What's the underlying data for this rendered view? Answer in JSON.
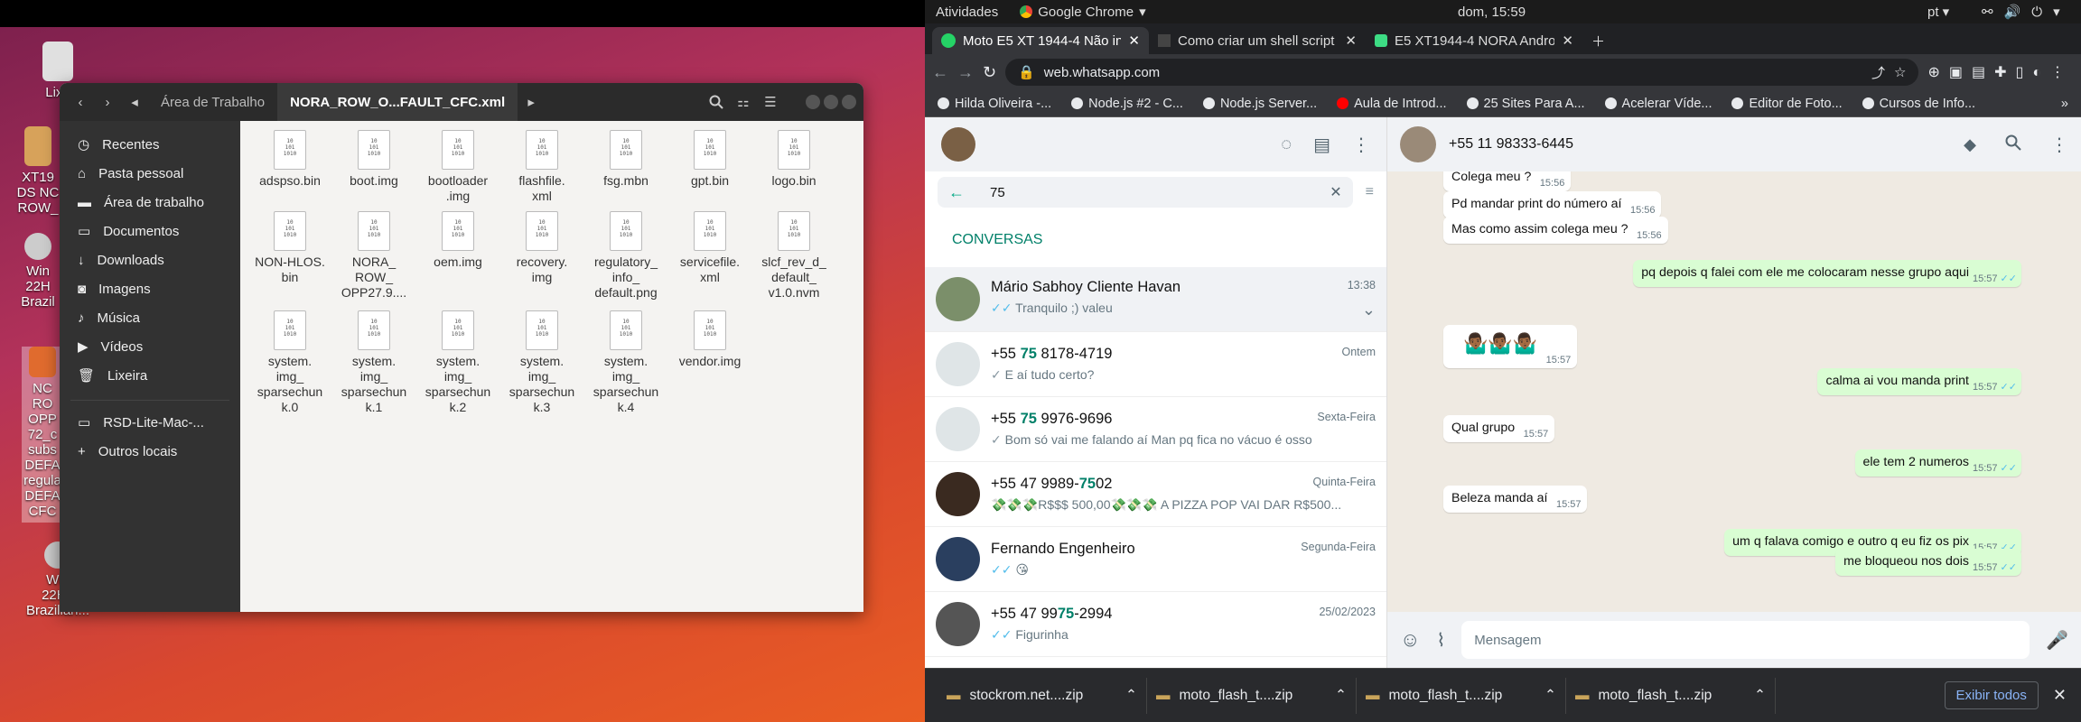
{
  "gnome": {
    "activities": "Atividades",
    "app": "Google Chrome",
    "clock": "dom, 15:59",
    "lang": "pt"
  },
  "desktop": {
    "icons": [
      "Lixe",
      "XT19\nDS NC\nROW_",
      "Win\n22H\nBrazil",
      "NC\nRO\nOPP\n72_c\nsubs\nDEFA\nregula\nDEFA\nCFC",
      "Win\n22H2\nBrazilian..."
    ]
  },
  "files": {
    "breadcrumb": [
      "Área de Trabalho",
      "NORA_ROW_O...FAULT_CFC.xml"
    ],
    "sidebar": [
      "Recentes",
      "Pasta pessoal",
      "Área de trabalho",
      "Documentos",
      "Downloads",
      "Imagens",
      "Música",
      "Vídeos",
      "Lixeira",
      "RSD-Lite-Mac-...",
      "Outros locais"
    ],
    "items": [
      "adspso.bin",
      "boot.img",
      "bootloader\n.img",
      "flashfile.\nxml",
      "fsg.mbn",
      "gpt.bin",
      "logo.bin",
      "NON-HLOS.\nbin",
      "NORA_\nROW_\nOPP27.9....",
      "oem.img",
      "recovery.\nimg",
      "regulatory_\ninfo_\ndefault.png",
      "servicefile.\nxml",
      "slcf_rev_d_\ndefault_\nv1.0.nvm",
      "system.\nimg_\nsparsechun\nk.0",
      "system.\nimg_\nsparsechun\nk.1",
      "system.\nimg_\nsparsechun\nk.2",
      "system.\nimg_\nsparsechun\nk.3",
      "system.\nimg_\nsparsechun\nk.4",
      "vendor.img"
    ]
  },
  "chrome": {
    "tabs": [
      "Moto E5 XT 1944-4 Não ini",
      "Como criar um shell script",
      "E5 XT1944-4 NORA Andro"
    ],
    "url": "web.whatsapp.com",
    "bookmarks": [
      "Hilda Oliveira -...",
      "Node.js #2 - C...",
      "Node.js Server...",
      "Aula de Introd...",
      "25 Sites Para A...",
      "Acelerar Víde...",
      "Editor de Foto...",
      "Cursos de Info..."
    ]
  },
  "wa": {
    "search": "75",
    "section": "CONVERSAS",
    "chats": [
      {
        "name": "Mário Sabhoy Cliente Havan",
        "time": "13:38",
        "last": "Tranquilo ;) valeu"
      },
      {
        "name_a": "+55 ",
        "name_h": "75",
        "name_b": " 8178-4719",
        "time": "Ontem",
        "last": "E aí tudo certo?"
      },
      {
        "name_a": "+55 ",
        "name_h": "75",
        "name_b": " 9976-9696",
        "time": "Sexta-Feira",
        "last": "Bom só vai me falando aí Man pq fica no vácuo é osso"
      },
      {
        "name_a": "+55 47 9989-",
        "name_h": "75",
        "name_b": "02",
        "time": "Quinta-Feira",
        "last": "💸💸💸R$$$ 500,00💸💸💸 A PIZZA POP VAI DAR R$500..."
      },
      {
        "name": "Fernando Engenheiro",
        "time": "Segunda-Feira",
        "last": "😘"
      },
      {
        "name_a": "+55 47 99",
        "name_h": "75",
        "name_b": "-2994",
        "time": "25/02/2023",
        "last": "Figurinha"
      }
    ],
    "contact": "+55 11 98333-6445",
    "messages": [
      {
        "dir": "in",
        "text": "Colega meu ?",
        "time": "15:56"
      },
      {
        "dir": "in",
        "text": "Pd mandar print do número aí",
        "time": "15:56"
      },
      {
        "dir": "in",
        "text": "Mas como assim colega meu ?",
        "time": "15:56"
      },
      {
        "dir": "out",
        "text": "pq depois q falei com ele me colocaram nesse grupo aqui",
        "time": "15:57"
      },
      {
        "dir": "in",
        "text": "🤷🏾‍♂️🤷🏾‍♂️🤷🏾‍♂️",
        "time": "15:57"
      },
      {
        "dir": "out",
        "text": "calma ai vou manda print",
        "time": "15:57"
      },
      {
        "dir": "in",
        "text": "Qual grupo",
        "time": "15:57"
      },
      {
        "dir": "out",
        "text": "ele tem 2 numeros",
        "time": "15:57"
      },
      {
        "dir": "in",
        "text": "Beleza manda aí",
        "time": "15:57"
      },
      {
        "dir": "out",
        "text": "um q falava comigo e outro q eu fiz os pix",
        "time": "15:57"
      },
      {
        "dir": "out",
        "text": "me bloqueou nos dois",
        "time": "15:57"
      }
    ],
    "input_placeholder": "Mensagem"
  },
  "downloads": {
    "items": [
      "stockrom.net....zip",
      "moto_flash_t....zip",
      "moto_flash_t....zip",
      "moto_flash_t....zip"
    ],
    "show_all": "Exibir todos"
  }
}
